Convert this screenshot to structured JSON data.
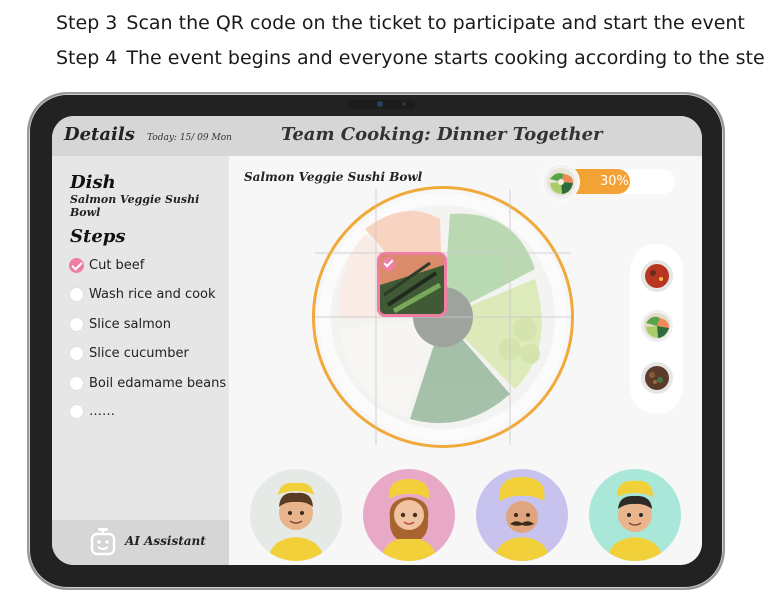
{
  "captions": [
    {
      "num": "Step 3",
      "text": "Scan the QR code on the ticket to participate and start the event"
    },
    {
      "num": "Step 4",
      "text": "The event begins and everyone starts cooking according to the steps"
    }
  ],
  "header": {
    "left_title": "Details",
    "date": "Today: 15/ 09 Mon",
    "title": "Team Cooking: Dinner Together"
  },
  "sidebar": {
    "dish_heading": "Dish",
    "dish_name": "Salmon Veggie Sushi Bowl",
    "steps_heading": "Steps",
    "steps": [
      {
        "label": "Cut beef",
        "done": true
      },
      {
        "label": "Wash rice and cook",
        "done": false
      },
      {
        "label": "Slice salmon",
        "done": false
      },
      {
        "label": "Slice cucumber",
        "done": false
      },
      {
        "label": "Boil edamame beans",
        "done": false
      },
      {
        "label": "……",
        "done": false
      }
    ],
    "assistant_label": "AI Assistant"
  },
  "main": {
    "dish_title": "Salmon Veggie Sushi Bowl",
    "progress": {
      "value": 0.3,
      "label": "30%"
    },
    "grid": {
      "rows": 3,
      "cols": 3,
      "completed_cell": 1
    }
  },
  "side_dishes": [
    "tomato-soup",
    "veggie-bowl",
    "beef-stew"
  ],
  "avatars": [
    {
      "name": "chef-man-1",
      "bg": "#e6eae6"
    },
    {
      "name": "chef-woman",
      "bg": "#e8a9c6"
    },
    {
      "name": "chef-mustache",
      "bg": "#c8c2ee"
    },
    {
      "name": "chef-boy",
      "bg": "#a9e8d8"
    }
  ],
  "colors": {
    "accent_orange": "#f3a236",
    "check_pink": "#ee7ea4",
    "sidebar_bg": "#e6e6e6",
    "header_bg": "#d6d6d6"
  }
}
